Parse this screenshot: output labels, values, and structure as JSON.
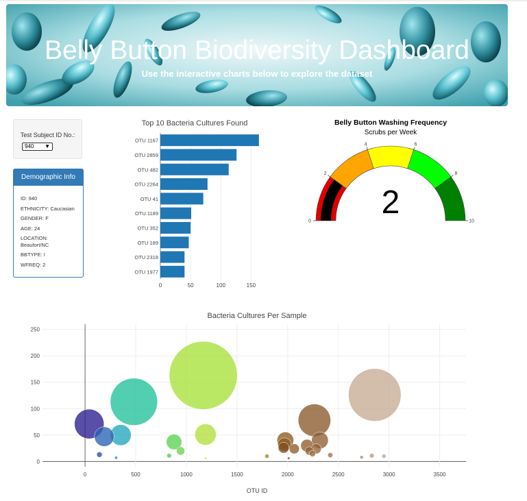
{
  "header": {
    "title": "Belly Button Biodiversity Dashboard",
    "subtitle": "Use the interactive charts below to explore the dataset"
  },
  "selector": {
    "label": "Test Subject ID No.:",
    "selected": "940"
  },
  "demographics": {
    "heading": "Demographic Info",
    "rows": [
      "ID: 940",
      "ETHNICITY: Caucasian",
      "GENDER: F",
      "AGE: 24",
      "LOCATION: Beaufort/NC",
      "BBTYPE: I",
      "WFREQ: 2"
    ]
  },
  "colors": {
    "bar": "#1f77b4",
    "panel_blue": "#337ab7"
  },
  "chart_data": [
    {
      "type": "bar",
      "orientation": "horizontal",
      "title": "Top 10 Bacteria Cultures Found",
      "categories": [
        "OTU 1167",
        "OTU 2859",
        "OTU 482",
        "OTU 2264",
        "OTU 41",
        "OTU 1189",
        "OTU 352",
        "OTU 189",
        "OTU 2318",
        "OTU 1977"
      ],
      "values": [
        163,
        126,
        113,
        78,
        71,
        51,
        50,
        47,
        40,
        40
      ],
      "xlim": [
        0,
        170
      ],
      "xticks": [
        0,
        50,
        100,
        150
      ],
      "grid": true
    },
    {
      "type": "gauge",
      "title": "Belly Button Washing Frequency",
      "subtitle": "Scrubs per Week",
      "value": 2,
      "range": [
        0,
        10
      ],
      "ticks": [
        0,
        2,
        4,
        6,
        8,
        10
      ],
      "steps": [
        {
          "range": [
            0,
            2
          ],
          "color": "#e00000"
        },
        {
          "range": [
            2,
            4
          ],
          "color": "#ffa500"
        },
        {
          "range": [
            4,
            6
          ],
          "color": "#ffff00"
        },
        {
          "range": [
            6,
            8
          ],
          "color": "#00ff00"
        },
        {
          "range": [
            8,
            10
          ],
          "color": "#008000"
        }
      ],
      "bar_color": "#000000"
    },
    {
      "type": "scatter",
      "title": "Bacteria Cultures Per Sample",
      "xlabel": "OTU ID",
      "xlim": [
        -420,
        3760
      ],
      "ylim": [
        -10,
        260
      ],
      "xticks": [
        0,
        500,
        1000,
        1500,
        2000,
        2500,
        3000,
        3500
      ],
      "yticks": [
        0,
        50,
        100,
        150,
        200,
        250
      ],
      "grid": true,
      "points": [
        {
          "x": 41,
          "y": 71,
          "color": "#2a1d8f"
        },
        {
          "x": 189,
          "y": 47,
          "color": "#2c63b3"
        },
        {
          "x": 352,
          "y": 50,
          "color": "#23a6bd"
        },
        {
          "x": 482,
          "y": 113,
          "color": "#20c29a"
        },
        {
          "x": 878,
          "y": 37,
          "color": "#5cd256"
        },
        {
          "x": 943,
          "y": 20,
          "color": "#6fd44e"
        },
        {
          "x": 1167,
          "y": 163,
          "color": "#a7e13a"
        },
        {
          "x": 1189,
          "y": 51,
          "color": "#b1e03c"
        },
        {
          "x": 1977,
          "y": 40,
          "color": "#8d5b22"
        },
        {
          "x": 1968,
          "y": 32,
          "color": "#8a5a20"
        },
        {
          "x": 1960,
          "y": 26,
          "color": "#7d4f1d"
        },
        {
          "x": 2065,
          "y": 24,
          "color": "#8e5c2a"
        },
        {
          "x": 2191,
          "y": 30,
          "color": "#8f5e2e"
        },
        {
          "x": 2213,
          "y": 20,
          "color": "#946332"
        },
        {
          "x": 2264,
          "y": 78,
          "color": "#8b5a2b"
        },
        {
          "x": 2282,
          "y": 24,
          "color": "#94643a"
        },
        {
          "x": 2318,
          "y": 40,
          "color": "#8e5e33"
        },
        {
          "x": 2245,
          "y": 15,
          "color": "#9a6a3e"
        },
        {
          "x": 2859,
          "y": 126,
          "color": "#c7aa94"
        },
        {
          "x": 2830,
          "y": 11,
          "color": "#b8977b"
        },
        {
          "x": 2950,
          "y": 10,
          "color": "#c2a78f"
        },
        {
          "x": 2730,
          "y": 8,
          "color": "#a8876a"
        },
        {
          "x": 2420,
          "y": 12,
          "color": "#9b7351"
        },
        {
          "x": 1795,
          "y": 10,
          "color": "#9a8a26"
        },
        {
          "x": 142,
          "y": 13,
          "color": "#2b4ea3"
        },
        {
          "x": 307,
          "y": 7,
          "color": "#2f7bc2"
        },
        {
          "x": 830,
          "y": 11,
          "color": "#4fcc5d"
        },
        {
          "x": 1190,
          "y": 6,
          "color": "#d5e04a"
        },
        {
          "x": 2010,
          "y": 6,
          "color": "#815327"
        }
      ]
    }
  ]
}
